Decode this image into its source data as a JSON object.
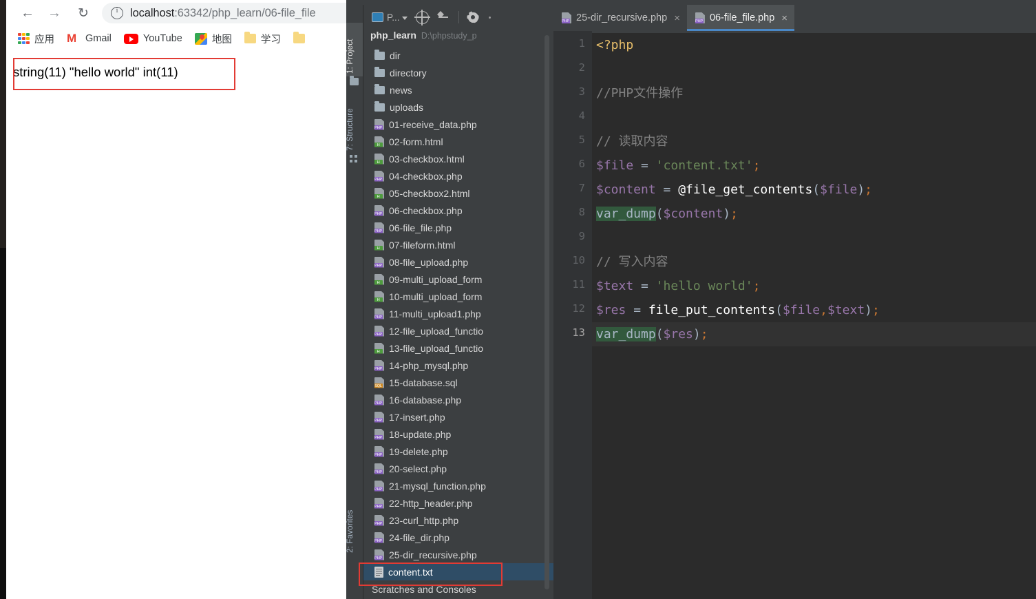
{
  "browser": {
    "nav": {
      "back_icon": "back-arrow-icon",
      "forward_icon": "forward-arrow-icon",
      "reload_icon": "reload-icon",
      "back_glyph": "←",
      "forward_glyph": "→",
      "reload_glyph": "↻"
    },
    "omnibox": {
      "url_host": "localhost",
      "url_rest": ":63342/php_learn/06-file_file",
      "info_icon": "site-info-icon"
    },
    "bookmarks": [
      {
        "label": "应用",
        "icon": "apps-grid-icon"
      },
      {
        "label": "Gmail",
        "icon": "gmail-icon"
      },
      {
        "label": "YouTube",
        "icon": "youtube-icon"
      },
      {
        "label": "地图",
        "icon": "google-maps-icon"
      },
      {
        "label": "学习",
        "icon": "folder-icon"
      },
      {
        "label": "",
        "icon": "folder-icon"
      }
    ],
    "page_output": "string(11) \"hello world\" int(11)"
  },
  "ide": {
    "project_toolbar": {
      "project_label": "P...",
      "project_icon": "project-view-icon",
      "caret_icon": "chevron-down-icon",
      "locate_icon": "scroll-from-source-icon",
      "collapse_icon": "collapse-all-icon",
      "settings_icon": "gear-icon"
    },
    "tool_tabs": {
      "project": "1: Project",
      "structure": "7: Structure",
      "favorites": "2: Favorites",
      "folder_icon": "folder-icon",
      "dots_icon": "module-dots-icon"
    },
    "project": {
      "name": "php_learn",
      "path": "D:\\phpstudy_p",
      "items": [
        {
          "name": "dir",
          "type": "folder"
        },
        {
          "name": "directory",
          "type": "folder"
        },
        {
          "name": "news",
          "type": "folder"
        },
        {
          "name": "uploads",
          "type": "folder"
        },
        {
          "name": "01-receive_data.php",
          "type": "php"
        },
        {
          "name": "02-form.html",
          "type": "html"
        },
        {
          "name": "03-checkbox.html",
          "type": "html"
        },
        {
          "name": "04-checkbox.php",
          "type": "php"
        },
        {
          "name": "05-checkbox2.html",
          "type": "html"
        },
        {
          "name": "06-checkbox.php",
          "type": "php"
        },
        {
          "name": "06-file_file.php",
          "type": "php"
        },
        {
          "name": "07-fileform.html",
          "type": "html"
        },
        {
          "name": "08-file_upload.php",
          "type": "php"
        },
        {
          "name": "09-multi_upload_form",
          "type": "html"
        },
        {
          "name": "10-multi_upload_form",
          "type": "html"
        },
        {
          "name": "11-multi_upload1.php",
          "type": "php"
        },
        {
          "name": "12-file_upload_functio",
          "type": "php"
        },
        {
          "name": "13-file_upload_functio",
          "type": "html"
        },
        {
          "name": "14-php_mysql.php",
          "type": "php"
        },
        {
          "name": "15-database.sql",
          "type": "sql"
        },
        {
          "name": "16-database.php",
          "type": "php"
        },
        {
          "name": "17-insert.php",
          "type": "php"
        },
        {
          "name": "18-update.php",
          "type": "php"
        },
        {
          "name": "19-delete.php",
          "type": "php"
        },
        {
          "name": "20-select.php",
          "type": "php"
        },
        {
          "name": "21-mysql_function.php",
          "type": "php"
        },
        {
          "name": "22-http_header.php",
          "type": "php"
        },
        {
          "name": "23-curl_http.php",
          "type": "php"
        },
        {
          "name": "24-file_dir.php",
          "type": "php"
        },
        {
          "name": "25-dir_recursive.php",
          "type": "php"
        },
        {
          "name": "content.txt",
          "type": "txt",
          "selected": true
        }
      ],
      "footer": "Scratches and Consoles"
    },
    "editor_tabs": [
      {
        "label": "25-dir_recursive.php",
        "icon": "php-file-icon",
        "close_glyph": "×",
        "active": false
      },
      {
        "label": "06-file_file.php",
        "icon": "php-file-icon",
        "close_glyph": "×",
        "active": true
      }
    ],
    "code": {
      "line_numbers": [
        "1",
        "2",
        "3",
        "4",
        "5",
        "6",
        "7",
        "8",
        "9",
        "10",
        "11",
        "12",
        "13"
      ],
      "current_line": 13,
      "lines": [
        {
          "n": 1,
          "tokens": [
            {
              "t": "<?php",
              "c": "tok-tag"
            }
          ]
        },
        {
          "n": 2,
          "tokens": []
        },
        {
          "n": 3,
          "tokens": [
            {
              "t": "//PHP文件操作",
              "c": "tok-cmt"
            }
          ]
        },
        {
          "n": 4,
          "tokens": []
        },
        {
          "n": 5,
          "tokens": [
            {
              "t": "// 读取内容",
              "c": "tok-cmt"
            }
          ]
        },
        {
          "n": 6,
          "tokens": [
            {
              "t": "$file",
              "c": "tok-var"
            },
            {
              "t": " = ",
              "c": "tok-plain"
            },
            {
              "t": "'content.txt'",
              "c": "tok-str"
            },
            {
              "t": ";",
              "c": "tok-punc"
            }
          ]
        },
        {
          "n": 7,
          "tokens": [
            {
              "t": "$content",
              "c": "tok-var"
            },
            {
              "t": " = ",
              "c": "tok-plain"
            },
            {
              "t": "@file_get_contents",
              "c": "tok-fn"
            },
            {
              "t": "(",
              "c": "tok-plain"
            },
            {
              "t": "$file",
              "c": "tok-var"
            },
            {
              "t": ")",
              "c": "tok-plain"
            },
            {
              "t": ";",
              "c": "tok-punc"
            }
          ]
        },
        {
          "n": 8,
          "tokens": [
            {
              "t": "var_dump",
              "c": "tok-hl"
            },
            {
              "t": "(",
              "c": "tok-plain"
            },
            {
              "t": "$content",
              "c": "tok-var"
            },
            {
              "t": ")",
              "c": "tok-plain"
            },
            {
              "t": ";",
              "c": "tok-punc"
            }
          ]
        },
        {
          "n": 9,
          "tokens": []
        },
        {
          "n": 10,
          "tokens": [
            {
              "t": "// 写入内容",
              "c": "tok-cmt"
            }
          ]
        },
        {
          "n": 11,
          "tokens": [
            {
              "t": "$text",
              "c": "tok-var"
            },
            {
              "t": " = ",
              "c": "tok-plain"
            },
            {
              "t": "'hello world'",
              "c": "tok-str"
            },
            {
              "t": ";",
              "c": "tok-punc"
            }
          ]
        },
        {
          "n": 12,
          "tokens": [
            {
              "t": "$res",
              "c": "tok-var"
            },
            {
              "t": " = ",
              "c": "tok-plain"
            },
            {
              "t": "file_put_contents",
              "c": "tok-fn"
            },
            {
              "t": "(",
              "c": "tok-plain"
            },
            {
              "t": "$file",
              "c": "tok-var"
            },
            {
              "t": ",",
              "c": "tok-punc"
            },
            {
              "t": "$text",
              "c": "tok-var"
            },
            {
              "t": ")",
              "c": "tok-plain"
            },
            {
              "t": ";",
              "c": "tok-punc"
            }
          ]
        },
        {
          "n": 13,
          "tokens": [
            {
              "t": "var_dump",
              "c": "tok-hl"
            },
            {
              "t": "(",
              "c": "tok-plain"
            },
            {
              "t": "$res",
              "c": "tok-var"
            },
            {
              "t": ")",
              "c": "tok-plain"
            },
            {
              "t": ";",
              "c": "tok-punc"
            }
          ]
        }
      ]
    }
  },
  "annotations": {
    "output_box_color": "#e23b34",
    "content_box_color": "#e23b34"
  }
}
